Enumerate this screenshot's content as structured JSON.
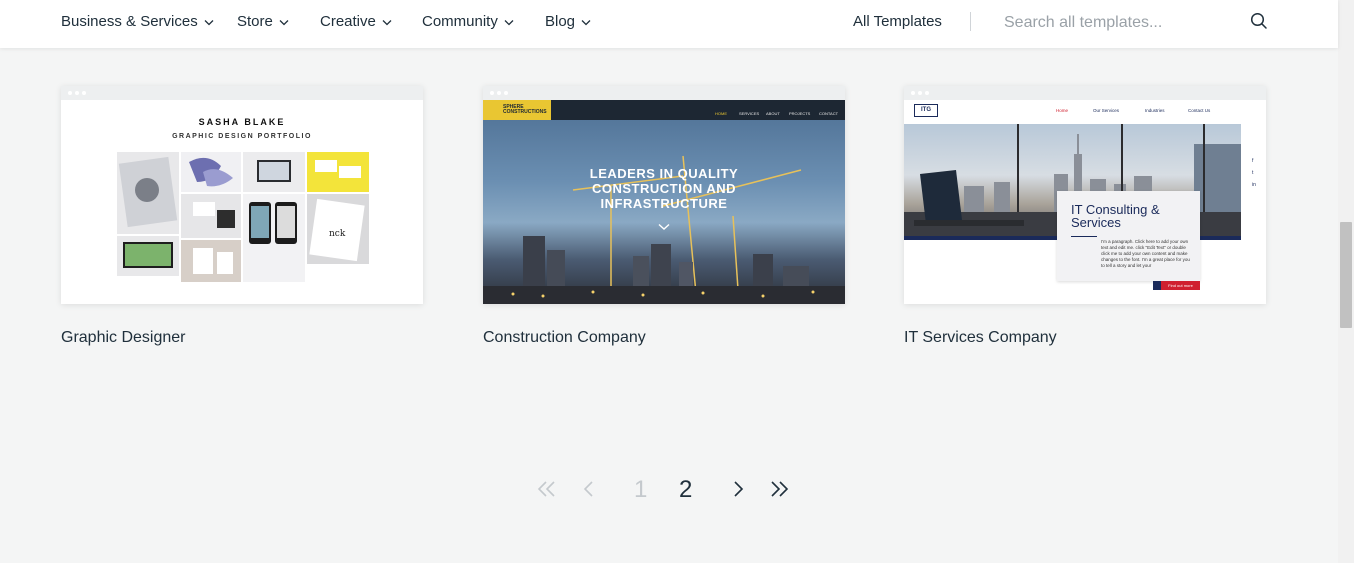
{
  "nav": {
    "items": [
      {
        "label": "Business & Services"
      },
      {
        "label": "Store"
      },
      {
        "label": "Creative"
      },
      {
        "label": "Community"
      },
      {
        "label": "Blog"
      }
    ],
    "all_templates": "All Templates",
    "search_placeholder": "Search all templates..."
  },
  "templates": [
    {
      "title": "Graphic Designer",
      "preview": {
        "name": "SASHA BLAKE",
        "subtitle": "GRAPHIC DESIGN PORTFOLIO"
      }
    },
    {
      "title": "Construction Company",
      "preview": {
        "logo": "SPHERE CONSTRUCTIONS",
        "menu": [
          "HOME",
          "SERVICES",
          "ABOUT",
          "PROJECTS",
          "CONTACT"
        ],
        "headline": "LEADERS IN QUALITY CONSTRUCTION AND INFRASTRUCTURE"
      }
    },
    {
      "title": "IT Services Company",
      "preview": {
        "logo": "ITG",
        "menu": [
          "Home",
          "Our Services",
          "Industries",
          "Contact Us"
        ],
        "box_title": "IT Consulting & Services",
        "box_text": "I'm a paragraph. Click here to add your own text and edit me. click \"Edit Text\" or double click me to add your own content and make changes to the font. I'm a great place for you to tell a story and let your",
        "button": "Find out more",
        "social": [
          "f",
          "t",
          "in"
        ]
      }
    }
  ],
  "pagination": {
    "pages": [
      "1",
      "2"
    ],
    "current": "2",
    "first": "«",
    "prev": "‹",
    "next": "›",
    "last": "»"
  },
  "colors": {
    "background": "#f4f5f5",
    "text": "#20303c",
    "disabled": "#c4c9cd",
    "accent_yellow": "#e9c632",
    "accent_navy": "#1a2a5a",
    "accent_red": "#d0202f"
  }
}
